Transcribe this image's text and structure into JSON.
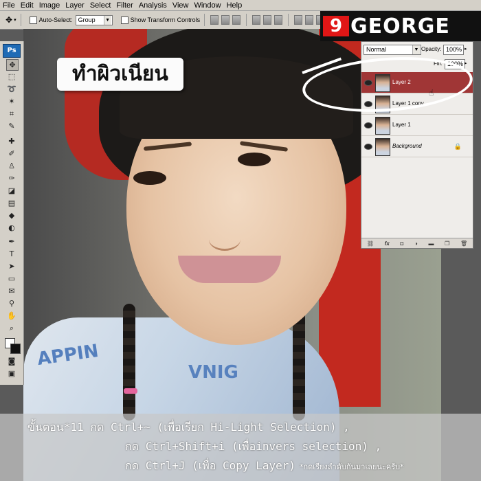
{
  "menubar": {
    "items": [
      "File",
      "Edit",
      "Image",
      "Layer",
      "Select",
      "Filter",
      "Analysis",
      "View",
      "Window",
      "Help"
    ]
  },
  "options": {
    "auto_select_label": "Auto-Select:",
    "auto_select_value": "Group",
    "show_transform_label": "Show Transform Controls"
  },
  "toolbox": {
    "logo": "Ps"
  },
  "brand": {
    "digit": "9",
    "name": "GEORGE"
  },
  "title_badge": "ทำผิวเนียน",
  "layers_panel": {
    "blend_mode": "Normal",
    "opacity_label": "Opacity:",
    "opacity_value": "100%",
    "fill_label": "Fill:",
    "fill_value": "100%",
    "layers": [
      {
        "name": "Layer 2",
        "active": true
      },
      {
        "name": "Layer 1 copy",
        "active": false
      },
      {
        "name": "Layer 1",
        "active": false
      },
      {
        "name": "Background",
        "active": false,
        "locked": true
      }
    ],
    "bottom_icons": [
      "link-icon",
      "fx-icon",
      "mask-icon",
      "adjustment-icon",
      "group-icon",
      "new-layer-icon",
      "trash-icon"
    ]
  },
  "caption": {
    "line1": "ขั้นตอน*11 กด Ctrl+~ (เพื่อเรียก Hi-Light Selection) ,",
    "line2": "กด Ctrl+Shift+i (เพื่อinvers selection) ,",
    "line3": "กด Ctrl+J (เพื่อ Copy Layer)",
    "note": "*กดเรียงลำดับกันมาเลยนะครับ*"
  },
  "photo": {
    "shirt_text_1": "APPIN",
    "shirt_text_2": "VNIG"
  },
  "colors": {
    "active_layer": "#a03636",
    "brand_red": "#e01616",
    "ps_blue": "#1f6bb5"
  }
}
